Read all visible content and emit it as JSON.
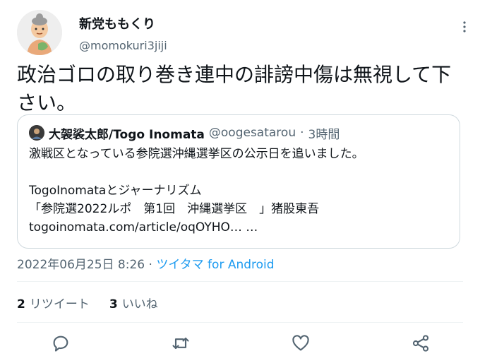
{
  "author": {
    "display_name": "新党ももくり",
    "handle": "@momokuri3jiji",
    "avatar_icon": "cartoon-avatar-icon"
  },
  "tweet": {
    "text": "政治ゴロの取り巻き連中の誹謗中傷は無視して下さい。"
  },
  "quoted_tweet": {
    "display_name": "大袈裟太郎/Togo Inomata",
    "handle": "@oogesatarou",
    "separator": "·",
    "time_ago": "3時間",
    "text": "激戦区となっている参院選沖縄選挙区の公示日を追いました。\n\nTogoInomataとジャーナリズム\n「参院選2022ルポ　第1回　沖縄選挙区　」猪股東吾\ntogoinomata.com/article/oqOYHO… …"
  },
  "meta": {
    "timestamp": "2022年06月25日 8:26",
    "separator": "·",
    "client": "ツイタマ for Android"
  },
  "stats": {
    "retweets_count": "2",
    "retweets_label": "リツイート",
    "likes_count": "3",
    "likes_label": "いいね"
  },
  "actions": [
    "reply-icon",
    "retweet-icon",
    "like-icon",
    "share-icon"
  ],
  "colors": {
    "accent": "#1d9bf0",
    "secondary_text": "#536471",
    "border": "#cfd9de"
  }
}
